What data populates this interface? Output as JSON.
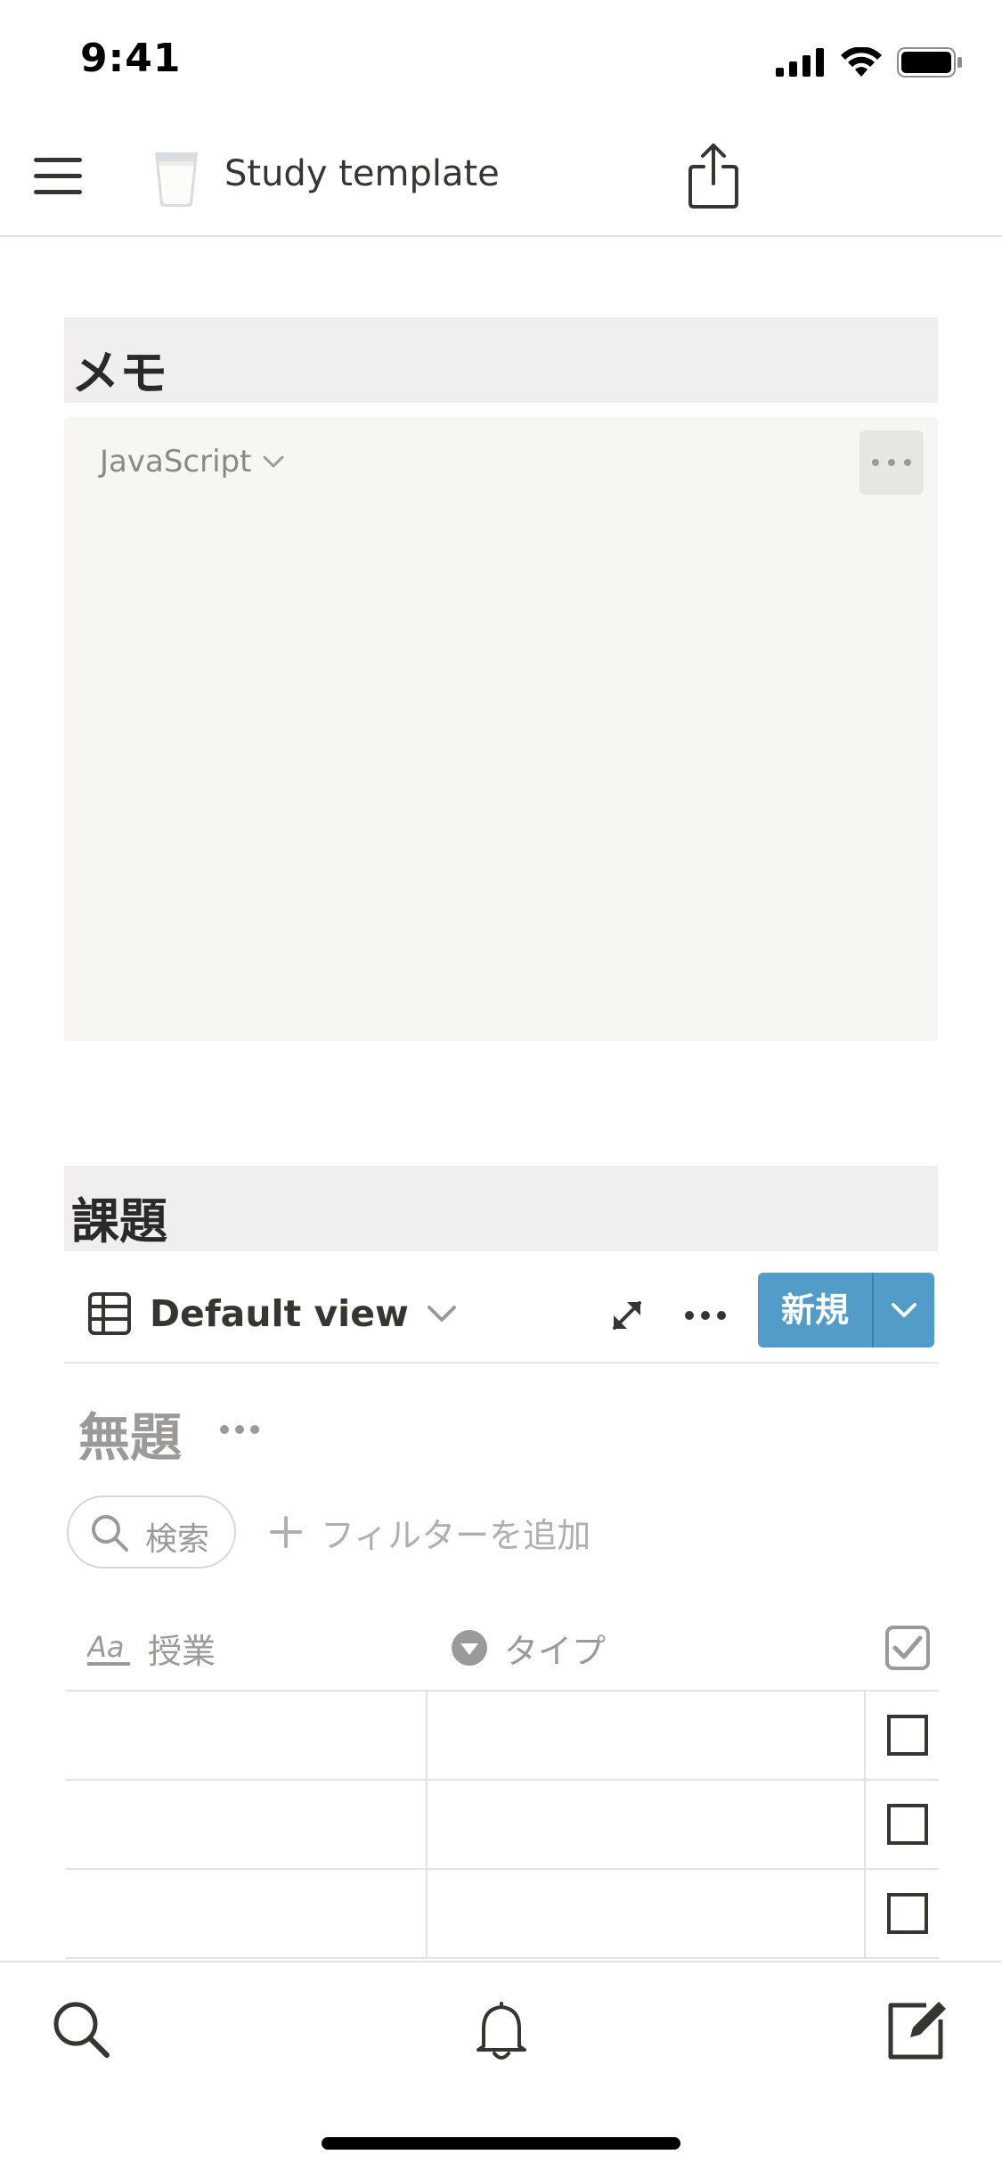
{
  "status_bar": {
    "time": "9:41",
    "icons": [
      "cellular-signal-icon",
      "wifi-icon",
      "battery-icon"
    ]
  },
  "topnav": {
    "menu_icon": "hamburger-menu-icon",
    "page_emoji": "glass-of-milk-emoji",
    "page_title": "Study template",
    "share_icon": "share-icon"
  },
  "memo_section": {
    "heading": "メモ",
    "code_block": {
      "language": "JavaScript",
      "content": "",
      "more_icon": "ellipsis-icon"
    }
  },
  "task_section": {
    "heading": "課題",
    "view": {
      "icon": "table-view-icon",
      "label": "Default view"
    },
    "new_button_label": "新規",
    "database_title": "無題",
    "search_label": "検索",
    "add_filter_label": "フィルターを追加",
    "columns": [
      {
        "label": "授業",
        "icon": "text-property-icon"
      },
      {
        "label": "タイプ",
        "icon": "select-property-icon"
      },
      {
        "label": "",
        "icon": "checkbox-property-icon"
      }
    ],
    "rows": [
      {
        "lesson": "",
        "type": "",
        "done": false
      },
      {
        "lesson": "",
        "type": "",
        "done": false
      },
      {
        "lesson": "",
        "type": "",
        "done": false
      }
    ]
  },
  "bottom_bar": {
    "tabs": [
      "search-icon",
      "bell-icon",
      "compose-icon"
    ]
  },
  "colors": {
    "accent": "#529cca",
    "heading_background": "#f1efee",
    "code_background": "#f7f6f3",
    "text": "#37352f",
    "muted_text": "#9b9a97"
  }
}
